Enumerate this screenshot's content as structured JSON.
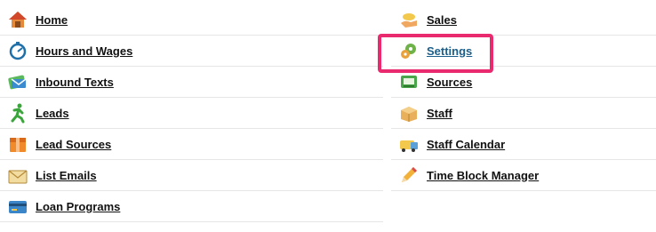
{
  "menu": {
    "left": [
      {
        "label": "Home",
        "icon": "house-icon"
      },
      {
        "label": "Hours and Wages",
        "icon": "stopwatch-icon"
      },
      {
        "label": "Inbound Texts",
        "icon": "envelope-text-icon"
      },
      {
        "label": "Leads",
        "icon": "running-person-icon"
      },
      {
        "label": "Lead Sources",
        "icon": "orange-box-icon"
      },
      {
        "label": "List Emails",
        "icon": "email-envelope-icon"
      },
      {
        "label": "Loan Programs",
        "icon": "credit-card-icon"
      }
    ],
    "right": [
      {
        "label": "Sales",
        "icon": "hand-money-icon"
      },
      {
        "label": "Settings",
        "icon": "gears-icon"
      },
      {
        "label": "Sources",
        "icon": "cash-register-icon"
      },
      {
        "label": "Staff",
        "icon": "package-box-icon"
      },
      {
        "label": "Staff Calendar",
        "icon": "van-calendar-icon"
      },
      {
        "label": "Time Block Manager",
        "icon": "pencil-icon"
      }
    ]
  },
  "highlight": {
    "item": "Settings",
    "color": "#ea2a6e"
  },
  "colors": {
    "link": "#111111",
    "active_link": "#1b5e8a",
    "divider": "#e6e6e6"
  }
}
